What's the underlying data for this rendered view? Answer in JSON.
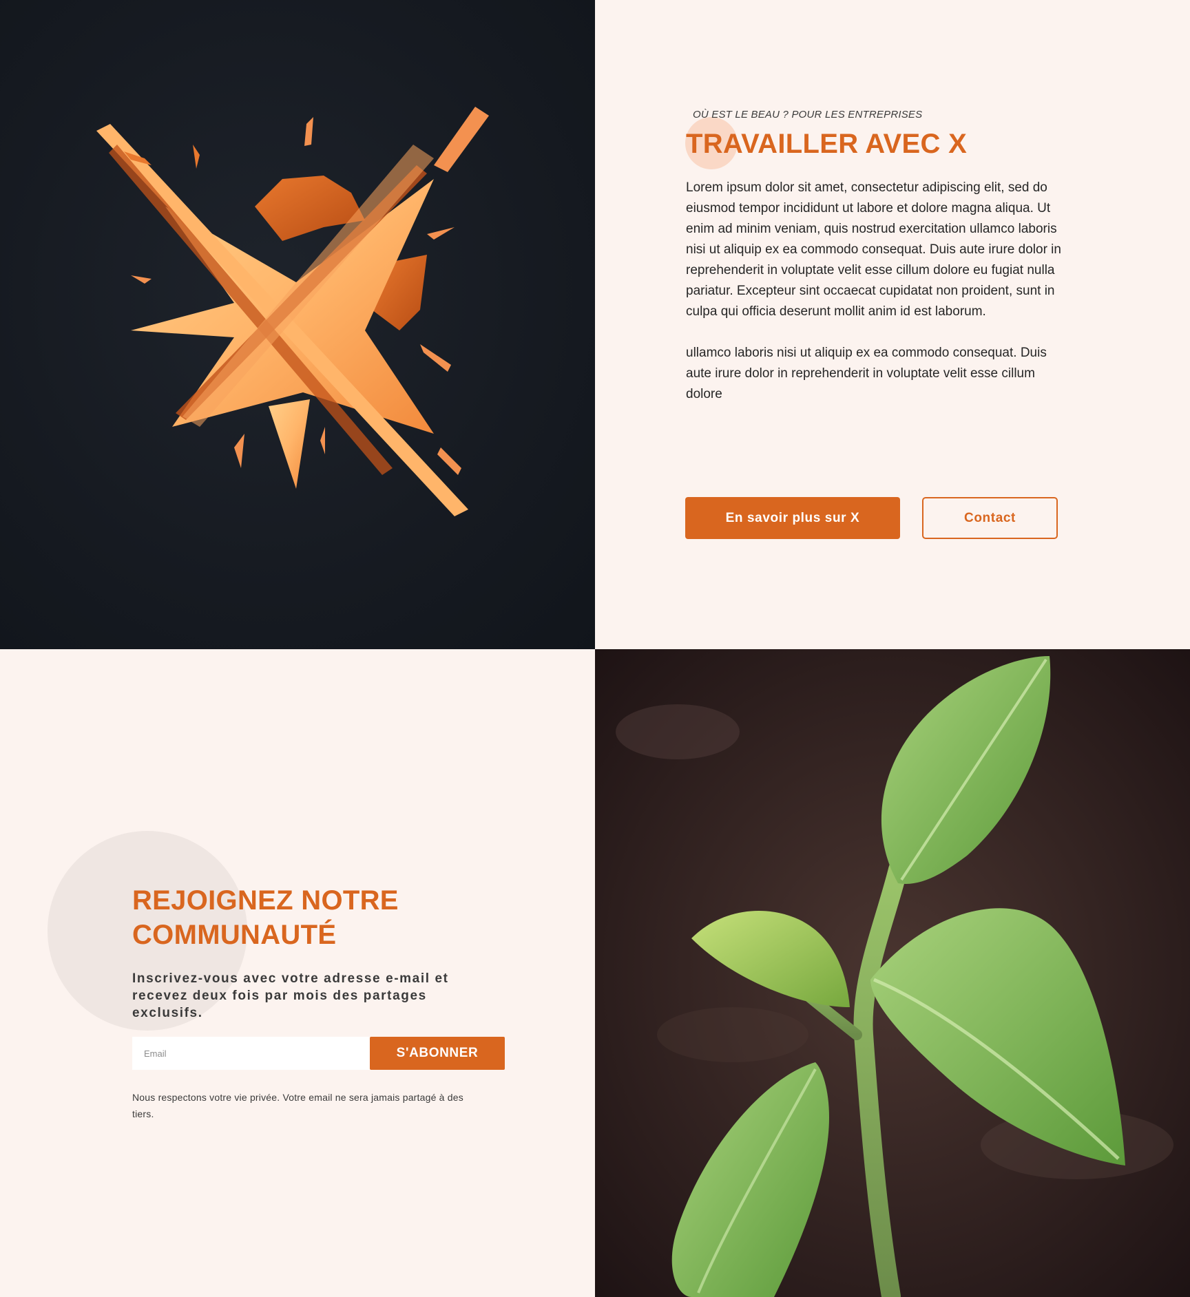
{
  "work_section": {
    "eyebrow": "OÙ EST LE BEAU ? POUR LES ENTREPRISES",
    "title": "TRAVAILLER AVEC X",
    "paragraph_1": "Lorem ipsum dolor sit amet, consectetur adipiscing elit, sed do eiusmod tempor incididunt ut labore et dolore magna aliqua. Ut enim ad minim veniam, quis nostrud exercitation ullamco laboris nisi ut aliquip ex ea commodo consequat. Duis aute irure dolor in reprehenderit in voluptate velit esse cillum dolore eu fugiat nulla pariatur. Excepteur sint occaecat cupidatat non proident, sunt in culpa qui officia deserunt mollit anim id est laborum.",
    "paragraph_2": "ullamco laboris nisi ut aliquip ex ea commodo consequat. Duis aute irure dolor in reprehenderit in voluptate velit esse cillum dolore",
    "primary_button": "En savoir plus sur X",
    "secondary_button": "Contact"
  },
  "community_section": {
    "title": "REJOIGNEZ NOTRE COMMUNAUTÉ",
    "subtitle": "Inscrivez-vous avec votre adresse e-mail et recevez deux fois par mois des partages exclusifs.",
    "email_placeholder": "Email",
    "subscribe_button": "S'ABONNER",
    "privacy_note": "Nous respectons votre vie privée. Votre email ne sera jamais partagé à des tiers."
  },
  "images": {
    "logo": "x-logo-illustration",
    "photo": "seedling-photo"
  },
  "colors": {
    "accent": "#d9661f",
    "background": "#fcf3ef",
    "dark_panel": "#161a21"
  }
}
